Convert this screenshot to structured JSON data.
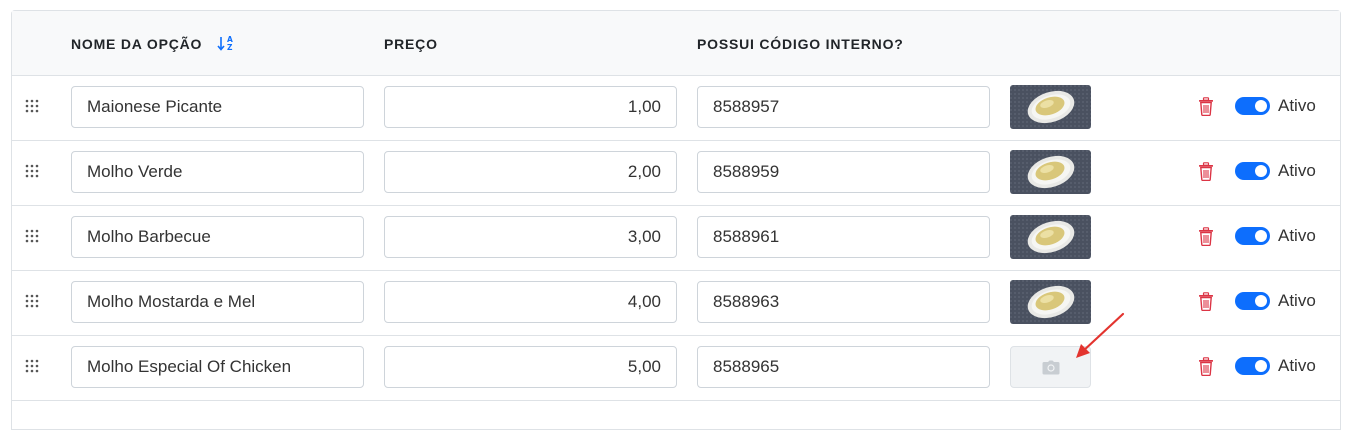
{
  "header": {
    "col_name": "NOME DA OPÇÃO",
    "col_price": "PREÇO",
    "col_code": "POSSUI CÓDIGO INTERNO?"
  },
  "rows": [
    {
      "name": "Maionese Picante",
      "price": "1,00",
      "code": "8588957",
      "has_image": true,
      "status": "Ativo",
      "active": true
    },
    {
      "name": "Molho Verde",
      "price": "2,00",
      "code": "8588959",
      "has_image": true,
      "status": "Ativo",
      "active": true
    },
    {
      "name": "Molho Barbecue",
      "price": "3,00",
      "code": "8588961",
      "has_image": true,
      "status": "Ativo",
      "active": true
    },
    {
      "name": "Molho Mostarda e Mel",
      "price": "4,00",
      "code": "8588963",
      "has_image": true,
      "status": "Ativo",
      "active": true
    },
    {
      "name": "Molho Especial Of Chicken",
      "price": "5,00",
      "code": "8588965",
      "has_image": false,
      "status": "Ativo",
      "active": true
    }
  ],
  "colors": {
    "accent": "#0d6efd",
    "delete": "#dc3545",
    "annotation_arrow": "#e3342f"
  },
  "icons": [
    "drag-handle-icon",
    "sort-alpha-icon",
    "trash-icon",
    "camera-icon",
    "arrow-annotation-icon"
  ]
}
